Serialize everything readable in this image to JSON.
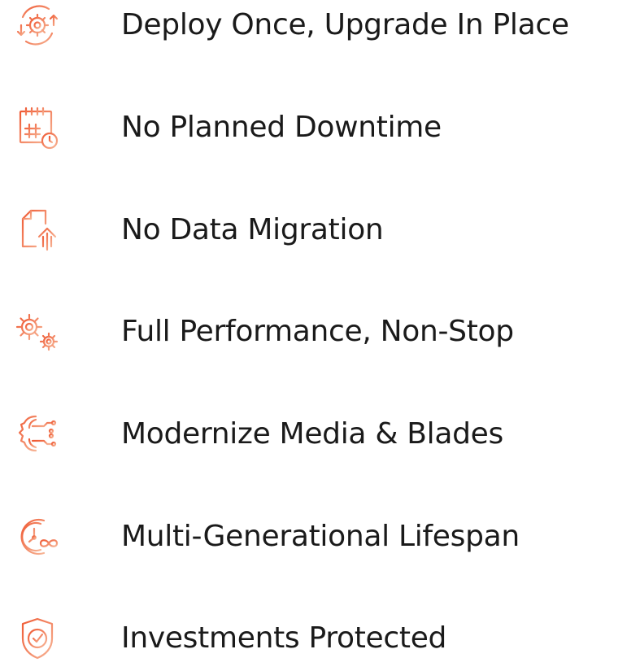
{
  "colors": {
    "icon_gradient_start": "#f0603a",
    "icon_gradient_end": "#f6b08e",
    "text": "#1a1a1a"
  },
  "features": [
    {
      "icon": "gear-cycle-icon",
      "label": "Deploy Once, Upgrade In Place"
    },
    {
      "icon": "calendar-clock-icon",
      "label": "No Planned Downtime"
    },
    {
      "icon": "document-upload-icon",
      "label": "No Data Migration"
    },
    {
      "icon": "gears-icon",
      "label": "Full Performance, Non-Stop"
    },
    {
      "icon": "circuit-brain-icon",
      "label": "Modernize Media & Blades"
    },
    {
      "icon": "timer-infinity-icon",
      "label": "Multi-Generational Lifespan"
    },
    {
      "icon": "shield-check-icon",
      "label": "Investments Protected"
    }
  ]
}
